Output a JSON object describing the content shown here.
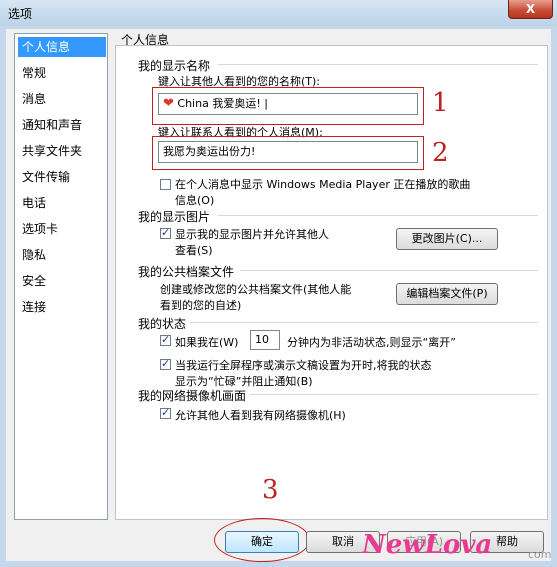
{
  "window": {
    "title": "选项",
    "close": "X"
  },
  "sidebar": {
    "items": [
      "个人信息",
      "常规",
      "消息",
      "通知和声音",
      "共享文件夹",
      "文件传输",
      "电话",
      "选项卡",
      "隐私",
      "安全",
      "连接"
    ]
  },
  "panel": {
    "title": "个人信息",
    "display_name": {
      "heading": "我的显示名称",
      "prompt": "键入让其他人看到的您的名称(T):",
      "value": "China 我爱奥运! |",
      "marker": "1"
    },
    "personal_message": {
      "prompt": "键入让联系人看到的个人消息(M):",
      "value": "我愿为奥运出份力!",
      "marker": "2",
      "show_media_line1": "在个人消息中显示 Windows Media Player 正在播放的歌曲",
      "show_media_line2": "信息(O)"
    },
    "picture": {
      "heading": "我的显示图片",
      "check_line1": "显示我的显示图片并允许其他人",
      "check_line2": "查看(S)",
      "button": "更改图片(C)..."
    },
    "profile": {
      "heading": "我的公共档案文件",
      "text_line1": "创建或修改您的公共档案文件(其他人能",
      "text_line2": "看到的您的自述)",
      "button": "编辑档案文件(P)"
    },
    "status": {
      "heading": "我的状态",
      "away_prefix": "如果我在(W)",
      "away_minutes": "10",
      "away_suffix": "分钟内为非活动状态,则显示“离开”",
      "busy_line1": "当我运行全屏程序或演示文稿设置为开时,将我的状态",
      "busy_line2": "显示为“忙碌”并阻止通知(B)"
    },
    "webcam": {
      "heading": "我的网络摄像机画面",
      "check": "允许其他人看到我有网络摄像机(H)"
    }
  },
  "footer": {
    "ok": "确定",
    "cancel": "取消",
    "apply": "应用(A)",
    "help": "帮助",
    "marker": "3"
  },
  "watermark": {
    "brand": "NewLova",
    "domain": "com"
  }
}
